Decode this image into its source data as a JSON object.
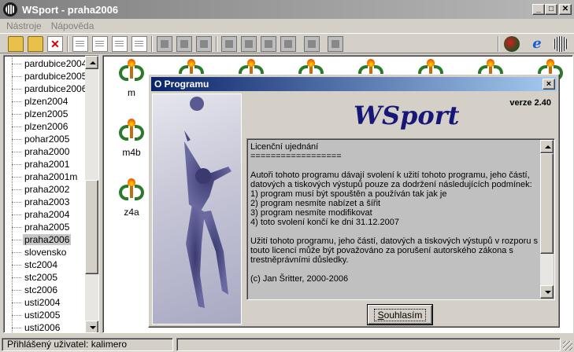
{
  "window": {
    "title": "WSport - praha2006"
  },
  "menu": [
    "Nástroje",
    "Nápověda"
  ],
  "toolbar": {
    "icons": [
      "open-folder-icon",
      "folder-icon",
      "delete-icon",
      "document-icon",
      "document-lines-icon",
      "document-chart-icon",
      "document-copy-icon",
      "edit-icon",
      "document-edit-icon",
      "print-icon",
      "grid-icon",
      "list-icon",
      "table-icon",
      "monitor-icon",
      "help-icon",
      "window-icon",
      "shield-globe-icon",
      "internet-explorer-icon",
      "wsport-globe-icon"
    ]
  },
  "tree": {
    "items": [
      "pardubice2004",
      "pardubice2005",
      "pardubice2006",
      "plzen2004",
      "plzen2005",
      "plzen2006",
      "pohar2005",
      "praha2000",
      "praha2001",
      "praha2001m",
      "praha2002",
      "praha2003",
      "praha2004",
      "praha2005",
      "praha2006",
      "slovensko",
      "stc2004",
      "stc2005",
      "stc2006",
      "usti2004",
      "usti2005",
      "usti2006"
    ],
    "selected": "praha2006"
  },
  "competitions": [
    {
      "label": "m"
    },
    {
      "label": ""
    },
    {
      "label": ""
    },
    {
      "label": ""
    },
    {
      "label": ""
    },
    {
      "label": ""
    },
    {
      "label": ""
    },
    {
      "label": ""
    },
    {
      "label": "m4b"
    },
    {
      "label": "z4a"
    }
  ],
  "dialog": {
    "title": "O Programu",
    "close": "×",
    "app_name": "WSport",
    "version": "verze 2.40",
    "license_text": "Licenční ujednání\n==================\n\nAutoři tohoto programu dávají svolení k užití tohoto programu, jeho částí,\ndatových a tiskových výstupů pouze za dodržení následujících podmínek:\n1) program musí být spouštěn a používán tak jak je\n2) program nesmíte nabízet a šířit\n3) program nesmíte modifikovat\n4) toto svolení končí ke dni 31.12.2007\n\nUžití tohoto programu, jeho částí, datových a tiskových výstupů v rozporu s\ntouto licencí může být považováno za porušení autorského zákona s\ntrestněprávními důsledky.\n\n(c) Jan Šritter, 2000-2006",
    "agree": "Souhlasím",
    "agree_hotkey": "S",
    "agree_rest": "ouhlasím"
  },
  "status": {
    "user_text": "Přihlášený uživatel: kalimero"
  }
}
